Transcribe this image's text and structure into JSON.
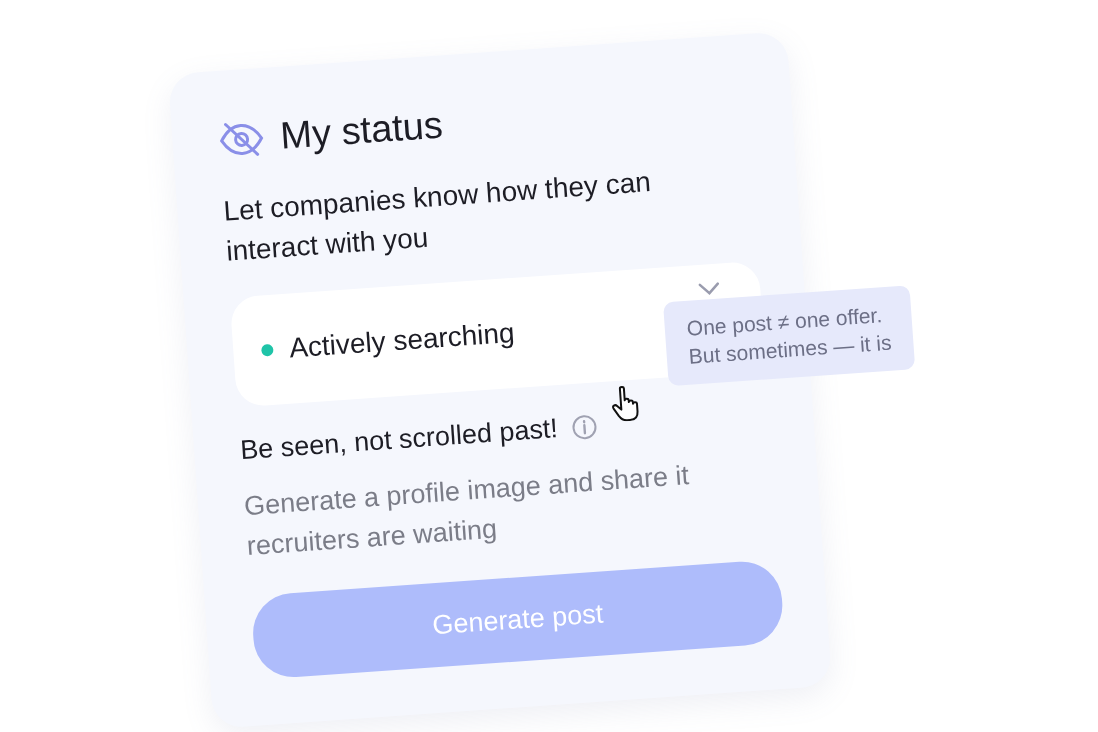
{
  "card": {
    "title": "My status",
    "description": "Let companies know how they can interact with you"
  },
  "status_select": {
    "value": "Actively searching"
  },
  "tooltip": {
    "lines": [
      "One post ≠ one offer.",
      "But sometimes — it is"
    ]
  },
  "promo": {
    "heading": "Be seen, not scrolled past!",
    "body": "Generate a profile image and share it recruiters are waiting"
  },
  "button": {
    "label": "Generate post",
    "disabled": true
  }
}
